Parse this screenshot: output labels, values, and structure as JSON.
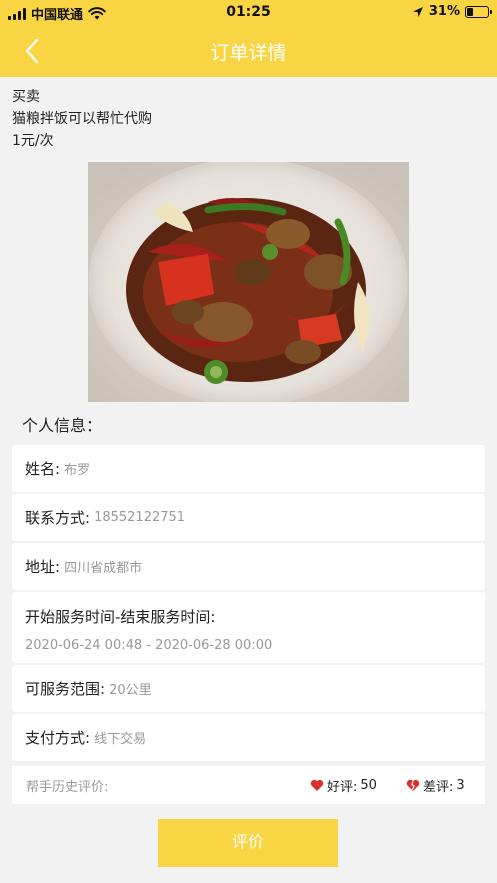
{
  "status_bar": {
    "carrier": "中国联通",
    "time": "01:25",
    "battery": "31%",
    "battery_level": 0.31
  },
  "nav": {
    "title": "订单详情",
    "back_icon": "chevron-left-icon"
  },
  "intro": {
    "category": "买卖",
    "description": "猫粮拌饭可以帮忙代购",
    "price": "1元/次"
  },
  "section_title": "个人信息：",
  "info": {
    "name_label": "姓名:",
    "name_value": "布罗",
    "contact_label": "联系方式:",
    "contact_value": "18552122751",
    "address_label": "地址:",
    "address_value": "四川省成都市",
    "service_time_label": "开始服务时间-结束服务时间:",
    "service_time_value": "2020-06-24 00:48 - 2020-06-28 00:00",
    "range_label": "可服务范围:",
    "range_value": "20公里",
    "payment_label": "支付方式:",
    "payment_value": "线下交易"
  },
  "rating": {
    "label": "帮手历史评价:",
    "good_label": "好评: ",
    "good_count": "50",
    "bad_label": "差评: ",
    "bad_count": "3",
    "color": "#d9312c"
  },
  "colors": {
    "accent": "#f9d443"
  },
  "button": {
    "label": "评价"
  }
}
